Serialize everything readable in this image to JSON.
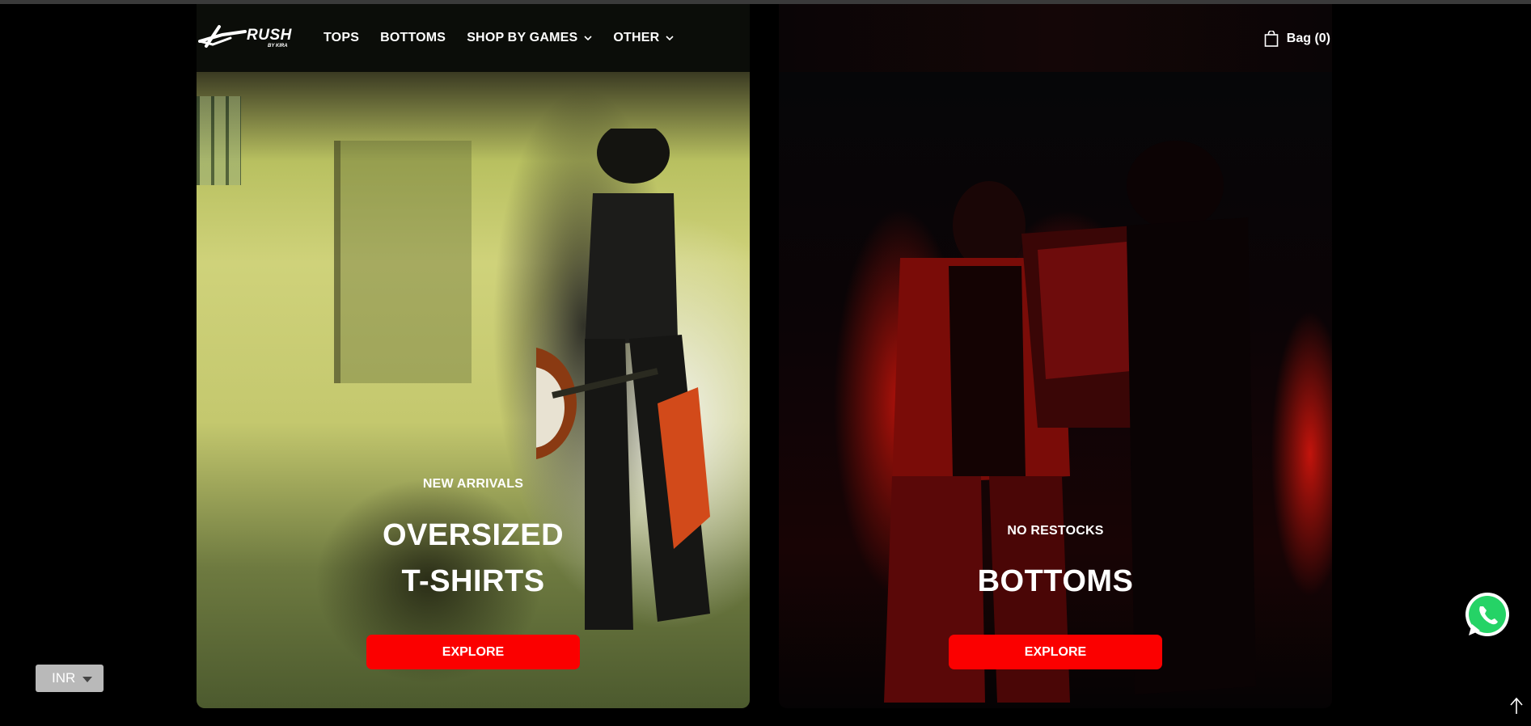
{
  "brand": {
    "name": "RUSH",
    "subtitle": "BY KIRA"
  },
  "nav": {
    "items": [
      {
        "label": "TOPS",
        "has_dropdown": false
      },
      {
        "label": "BOTTOMS",
        "has_dropdown": false
      },
      {
        "label": "SHOP BY GAMES",
        "has_dropdown": true
      },
      {
        "label": "OTHER",
        "has_dropdown": true
      }
    ]
  },
  "cart": {
    "label": "Bag (0)",
    "icon": "shopping-bag-icon"
  },
  "panels": [
    {
      "eyebrow": "NEW ARRIVALS",
      "title_line1": "OVERSIZED",
      "title_line2": "T-SHIRTS",
      "button": "EXPLORE"
    },
    {
      "eyebrow": "NO RESTOCKS",
      "title_line1": "BOTTOMS",
      "button": "EXPLORE"
    }
  ],
  "currency": {
    "selected": "INR"
  },
  "colors": {
    "accent": "#fb0000",
    "background": "#000000",
    "whatsapp": "#25d366"
  },
  "icons": {
    "whatsapp": "whatsapp-icon",
    "scroll_top": "arrow-up-icon",
    "dropdown": "chevron-down-icon"
  }
}
